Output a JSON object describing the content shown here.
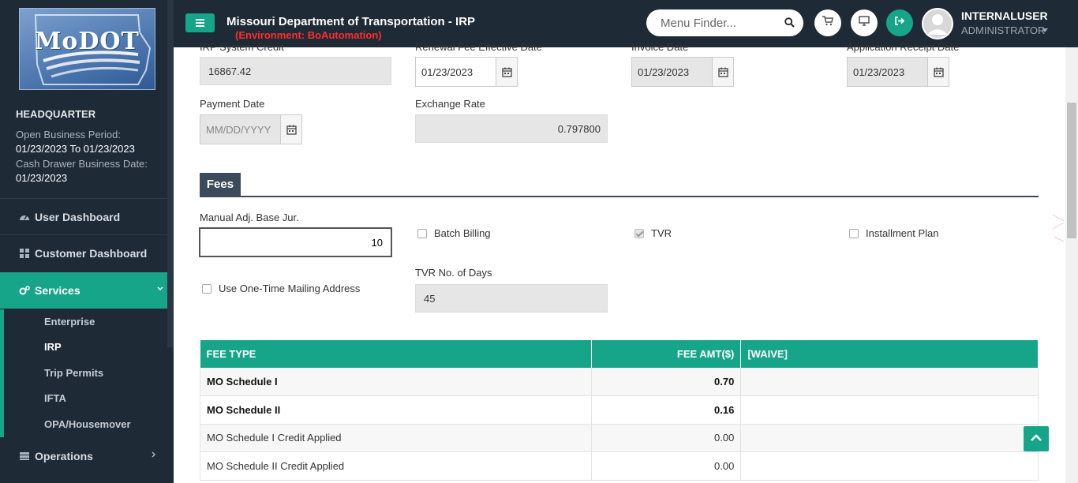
{
  "sidebar": {
    "logo_text": "MoDOT",
    "office": "HEADQUARTER",
    "open_period_label": "Open Business Period:",
    "open_period_value": "01/23/2023 To 01/23/2023",
    "cash_drawer_label": "Cash Drawer Business Date:",
    "cash_drawer_value": "01/23/2023",
    "nav": {
      "user_dashboard": "User Dashboard",
      "customer_dashboard": "Customer Dashboard",
      "services": "Services",
      "operations": "Operations"
    },
    "services_submenu": [
      "Enterprise",
      "IRP",
      "Trip Permits",
      "IFTA",
      "OPA/Housemover"
    ]
  },
  "header": {
    "title": "Missouri Department of Transportation - IRP",
    "environment": "(Environment: BoAutomation)",
    "menu_finder_placeholder": "Menu Finder...",
    "user_name": "INTERNALUSER",
    "user_role": "ADMINISTRATOR"
  },
  "form": {
    "irp_credit_label": "IRP System Credit",
    "irp_credit_value": "16867.42",
    "renewal_fee_label": "Renewal Fee Effective Date",
    "renewal_fee_value": "01/23/2023",
    "invoice_date_label": "Invoice Date",
    "invoice_date_value": "01/23/2023",
    "app_receipt_label": "Application Receipt Date",
    "app_receipt_value": "01/23/2023",
    "payment_date_label": "Payment Date",
    "payment_date_placeholder": "MM/DD/YYYY",
    "exchange_rate_label": "Exchange Rate",
    "exchange_rate_value": "0.797800",
    "fees_title": "Fees",
    "manual_adj_label": "Manual Adj. Base Jur.",
    "manual_adj_value": "10",
    "batch_billing_label": "Batch Billing",
    "tvr_label": "TVR",
    "installment_label": "Installment Plan",
    "one_time_mailing_label": "Use One-Time Mailing Address",
    "tvr_days_label": "TVR No. of Days",
    "tvr_days_value": "45"
  },
  "fee_table": {
    "headers": [
      "FEE TYPE",
      "FEE AMT($)",
      "[WAIVE]"
    ],
    "rows": [
      {
        "type": "MO Schedule I",
        "amount": "0.70",
        "waive": ""
      },
      {
        "type": "MO Schedule II",
        "amount": "0.16",
        "waive": ""
      },
      {
        "type": "MO Schedule I Credit Applied",
        "amount": "0.00",
        "waive": ""
      },
      {
        "type": "MO Schedule II Credit Applied",
        "amount": "0.00",
        "waive": ""
      }
    ]
  },
  "colors": {
    "sidebar_bg": "#1e2a36",
    "accent": "#17a589",
    "env_red": "#ff2d2d",
    "fees_header_bg": "#3c4b5a"
  }
}
